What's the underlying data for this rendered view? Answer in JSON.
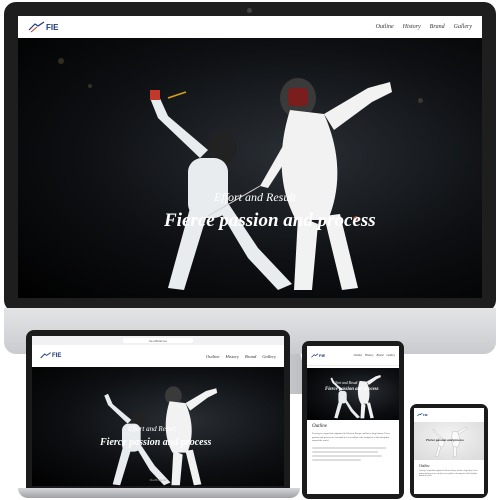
{
  "site": {
    "logo": "FIE",
    "nav": [
      "Outline",
      "History",
      "Brand",
      "Gallery"
    ],
    "hero_subtitle": "Effort and Result",
    "hero_title": "Fierce passion and process",
    "outline_heading": "Outline",
    "outline_text": "Fencing is a sport that originated in Western Europe and has a long history. Fierce passion and process are essential to every athlete who competes in this discipline around the world."
  },
  "devices": {
    "imac": {
      "label": "iMac"
    },
    "macbook": {
      "label": "MacBook Air",
      "url": "fie-official.net"
    },
    "ipad": {
      "label": "iPad"
    },
    "phone": {
      "label": "iPhone"
    }
  },
  "icons": {
    "logo": "fie-logo-icon",
    "camera": "camera-icon"
  },
  "colors": {
    "brand": "#1b3a7a",
    "hero_bg": "#000000",
    "device_frame": "#1e1e1e"
  }
}
